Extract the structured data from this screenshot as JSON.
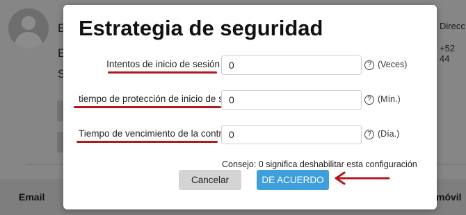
{
  "background": {
    "left_letters": [
      "E",
      "E",
      "S"
    ],
    "right_texts": [
      "Direcc",
      "+52 44"
    ],
    "table_headers": [
      "Email",
      "móvil"
    ]
  },
  "dialog": {
    "title": "Estrategia de seguridad",
    "fields": [
      {
        "label": "Intentos de inicio de sesión",
        "value": "0",
        "unit": "(Veces)",
        "help": "?"
      },
      {
        "label": "tiempo de protección de inicio de sesión",
        "value": "0",
        "unit": "(Mín.)",
        "help": "?"
      },
      {
        "label": "Tiempo de vencimiento de la contraseña",
        "value": "0",
        "unit": "(Día.)",
        "help": "?"
      }
    ],
    "tip": "Consejo: 0 significa deshabilitar esta configuración",
    "cancel_label": "Cancelar",
    "ok_label": "DE ACUERDO"
  },
  "colors": {
    "annotation_red": "#b5171c",
    "ok_button": "#3f9fdc",
    "cancel_button": "#d4d4d4"
  }
}
